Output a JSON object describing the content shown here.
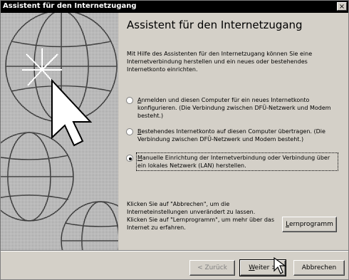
{
  "window": {
    "title": "Assistent für den Internetzugang",
    "close_label": "×"
  },
  "heading": "Assistent für den Internetzugang",
  "intro": "Mit Hilfe des Assistenten für den Internetzugang können Sie eine Internetverbindung herstellen und ein neues oder bestehendes Internetkonto einrichten.",
  "options": [
    {
      "label_rest": "nmelden und diesen Computer für ein neues Internetkonto konfigurieren. (Die Verbindung zwischen DFÜ-Netzwerk und Modem besteht.)",
      "accel": "A",
      "selected": false
    },
    {
      "label_rest": "estehendes Internetkonto auf diesen Computer übertragen. (Die Verbindung zwischen DFÜ-Netzwerk und Modem besteht.)",
      "accel": "B",
      "selected": false
    },
    {
      "label_rest": "anuelle Einrichtung der Internetverbindung oder Verbindung über ein lokales Netzwerk (LAN) herstellen.",
      "accel": "M",
      "selected": true
    }
  ],
  "bottom": {
    "cancel_hint": "Klicken Sie auf \"Abbrechen\", um die Interneteinstellungen unverändert zu lassen.",
    "tutorial_hint": "Klicken Sie auf \"Lernprogramm\", um mehr über das Internet zu erfahren."
  },
  "buttons": {
    "tutorial_accel": "L",
    "tutorial_rest": "ernprogramm",
    "back": "< Zurück",
    "next_accel": "W",
    "next_rest": "eiter >",
    "cancel": "Abbrechen"
  },
  "colors": {
    "titlebar": "#000000",
    "face": "#d4d0c8",
    "art": "#b8b8b8"
  },
  "icons": [
    "close-icon",
    "globe-icon",
    "starburst-icon",
    "arrow-cursor-icon",
    "radio-icon",
    "hand-cursor-icon"
  ]
}
